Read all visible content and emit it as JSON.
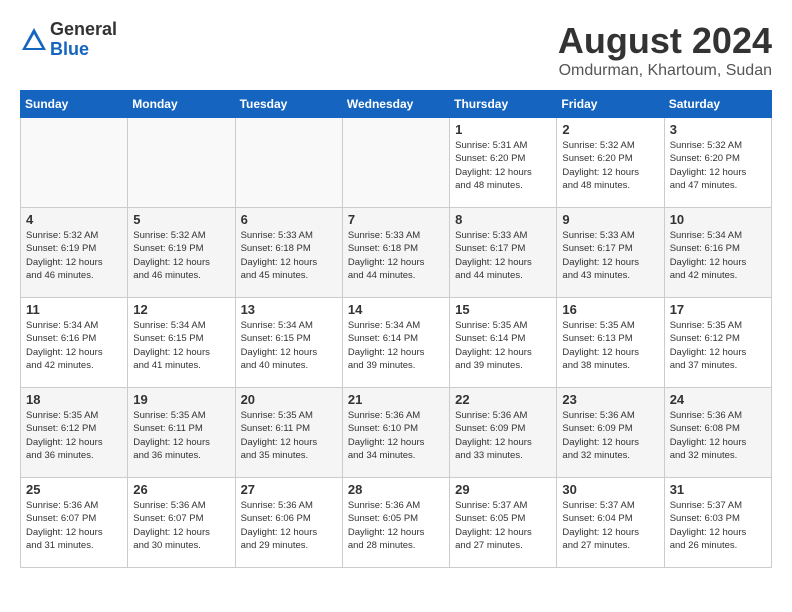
{
  "logo": {
    "general": "General",
    "blue": "Blue"
  },
  "title": {
    "month": "August 2024",
    "location": "Omdurman, Khartoum, Sudan"
  },
  "days_of_week": [
    "Sunday",
    "Monday",
    "Tuesday",
    "Wednesday",
    "Thursday",
    "Friday",
    "Saturday"
  ],
  "weeks": [
    [
      {
        "day": "",
        "info": ""
      },
      {
        "day": "",
        "info": ""
      },
      {
        "day": "",
        "info": ""
      },
      {
        "day": "",
        "info": ""
      },
      {
        "day": "1",
        "info": "Sunrise: 5:31 AM\nSunset: 6:20 PM\nDaylight: 12 hours\nand 48 minutes."
      },
      {
        "day": "2",
        "info": "Sunrise: 5:32 AM\nSunset: 6:20 PM\nDaylight: 12 hours\nand 48 minutes."
      },
      {
        "day": "3",
        "info": "Sunrise: 5:32 AM\nSunset: 6:20 PM\nDaylight: 12 hours\nand 47 minutes."
      }
    ],
    [
      {
        "day": "4",
        "info": "Sunrise: 5:32 AM\nSunset: 6:19 PM\nDaylight: 12 hours\nand 46 minutes."
      },
      {
        "day": "5",
        "info": "Sunrise: 5:32 AM\nSunset: 6:19 PM\nDaylight: 12 hours\nand 46 minutes."
      },
      {
        "day": "6",
        "info": "Sunrise: 5:33 AM\nSunset: 6:18 PM\nDaylight: 12 hours\nand 45 minutes."
      },
      {
        "day": "7",
        "info": "Sunrise: 5:33 AM\nSunset: 6:18 PM\nDaylight: 12 hours\nand 44 minutes."
      },
      {
        "day": "8",
        "info": "Sunrise: 5:33 AM\nSunset: 6:17 PM\nDaylight: 12 hours\nand 44 minutes."
      },
      {
        "day": "9",
        "info": "Sunrise: 5:33 AM\nSunset: 6:17 PM\nDaylight: 12 hours\nand 43 minutes."
      },
      {
        "day": "10",
        "info": "Sunrise: 5:34 AM\nSunset: 6:16 PM\nDaylight: 12 hours\nand 42 minutes."
      }
    ],
    [
      {
        "day": "11",
        "info": "Sunrise: 5:34 AM\nSunset: 6:16 PM\nDaylight: 12 hours\nand 42 minutes."
      },
      {
        "day": "12",
        "info": "Sunrise: 5:34 AM\nSunset: 6:15 PM\nDaylight: 12 hours\nand 41 minutes."
      },
      {
        "day": "13",
        "info": "Sunrise: 5:34 AM\nSunset: 6:15 PM\nDaylight: 12 hours\nand 40 minutes."
      },
      {
        "day": "14",
        "info": "Sunrise: 5:34 AM\nSunset: 6:14 PM\nDaylight: 12 hours\nand 39 minutes."
      },
      {
        "day": "15",
        "info": "Sunrise: 5:35 AM\nSunset: 6:14 PM\nDaylight: 12 hours\nand 39 minutes."
      },
      {
        "day": "16",
        "info": "Sunrise: 5:35 AM\nSunset: 6:13 PM\nDaylight: 12 hours\nand 38 minutes."
      },
      {
        "day": "17",
        "info": "Sunrise: 5:35 AM\nSunset: 6:12 PM\nDaylight: 12 hours\nand 37 minutes."
      }
    ],
    [
      {
        "day": "18",
        "info": "Sunrise: 5:35 AM\nSunset: 6:12 PM\nDaylight: 12 hours\nand 36 minutes."
      },
      {
        "day": "19",
        "info": "Sunrise: 5:35 AM\nSunset: 6:11 PM\nDaylight: 12 hours\nand 36 minutes."
      },
      {
        "day": "20",
        "info": "Sunrise: 5:35 AM\nSunset: 6:11 PM\nDaylight: 12 hours\nand 35 minutes."
      },
      {
        "day": "21",
        "info": "Sunrise: 5:36 AM\nSunset: 6:10 PM\nDaylight: 12 hours\nand 34 minutes."
      },
      {
        "day": "22",
        "info": "Sunrise: 5:36 AM\nSunset: 6:09 PM\nDaylight: 12 hours\nand 33 minutes."
      },
      {
        "day": "23",
        "info": "Sunrise: 5:36 AM\nSunset: 6:09 PM\nDaylight: 12 hours\nand 32 minutes."
      },
      {
        "day": "24",
        "info": "Sunrise: 5:36 AM\nSunset: 6:08 PM\nDaylight: 12 hours\nand 32 minutes."
      }
    ],
    [
      {
        "day": "25",
        "info": "Sunrise: 5:36 AM\nSunset: 6:07 PM\nDaylight: 12 hours\nand 31 minutes."
      },
      {
        "day": "26",
        "info": "Sunrise: 5:36 AM\nSunset: 6:07 PM\nDaylight: 12 hours\nand 30 minutes."
      },
      {
        "day": "27",
        "info": "Sunrise: 5:36 AM\nSunset: 6:06 PM\nDaylight: 12 hours\nand 29 minutes."
      },
      {
        "day": "28",
        "info": "Sunrise: 5:36 AM\nSunset: 6:05 PM\nDaylight: 12 hours\nand 28 minutes."
      },
      {
        "day": "29",
        "info": "Sunrise: 5:37 AM\nSunset: 6:05 PM\nDaylight: 12 hours\nand 27 minutes."
      },
      {
        "day": "30",
        "info": "Sunrise: 5:37 AM\nSunset: 6:04 PM\nDaylight: 12 hours\nand 27 minutes."
      },
      {
        "day": "31",
        "info": "Sunrise: 5:37 AM\nSunset: 6:03 PM\nDaylight: 12 hours\nand 26 minutes."
      }
    ]
  ]
}
